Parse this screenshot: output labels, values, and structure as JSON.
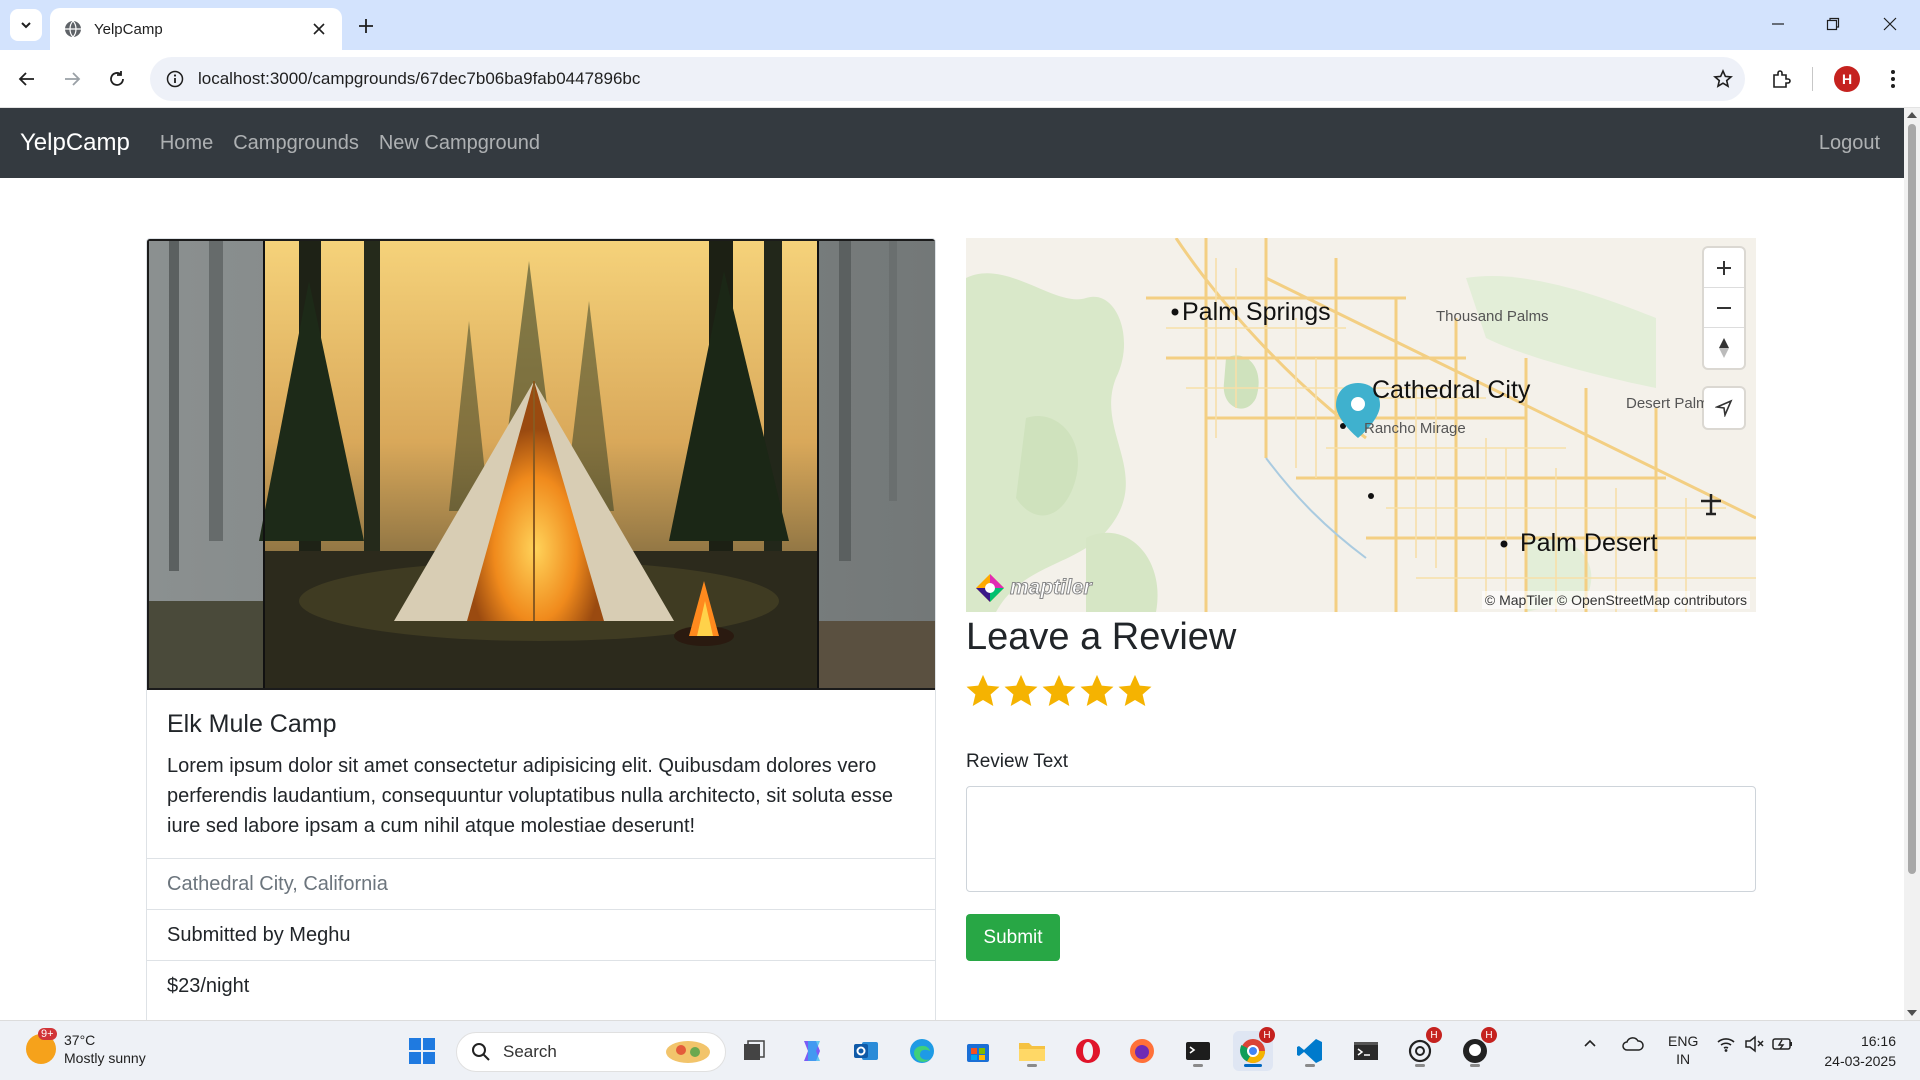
{
  "browser": {
    "tab_title": "YelpCamp",
    "url": "localhost:3000/campgrounds/67dec7b06ba9fab0447896bc",
    "profile_initial": "H"
  },
  "navbar": {
    "brand": "YelpCamp",
    "links": [
      "Home",
      "Campgrounds",
      "New Campground"
    ],
    "logout": "Logout"
  },
  "campground": {
    "title": "Elk Mule Camp",
    "description": "Lorem ipsum dolor sit amet consectetur adipisicing elit. Quibusdam dolores vero perferendis laudantium, consequuntur voluptatibus nulla architecto, sit soluta esse iure sed labore ipsam a cum nihil atque molestiae deserunt!",
    "location": "Cathedral City, California",
    "submitted_by": "Submitted by Meghu",
    "price": "$23/night"
  },
  "map": {
    "labels": {
      "palm_springs": "Palm Springs",
      "thousand_palms": "Thousand Palms",
      "cathedral_city": "Cathedral City",
      "desert_palms": "Desert Palms",
      "rancho_mirage": "Rancho Mirage",
      "palm_desert": "Palm Desert"
    },
    "logo": "maptiler",
    "attribution": "© MapTiler © OpenStreetMap contributors"
  },
  "review": {
    "heading": "Leave a Review",
    "rating": 5,
    "rating_max": 5,
    "text_label": "Review Text",
    "text_value": "",
    "submit": "Submit"
  },
  "taskbar": {
    "weather_temp": "37°C",
    "weather_desc": "Mostly sunny",
    "weather_badge": "9+",
    "search": "Search",
    "lang_top": "ENG",
    "lang_bottom": "IN",
    "time": "16:16",
    "date": "24-03-2025"
  },
  "colors": {
    "navbar_bg": "#343a40",
    "submit_bg": "#28a745",
    "star": "#f5b301",
    "tabstrip": "#d3e3fd"
  }
}
